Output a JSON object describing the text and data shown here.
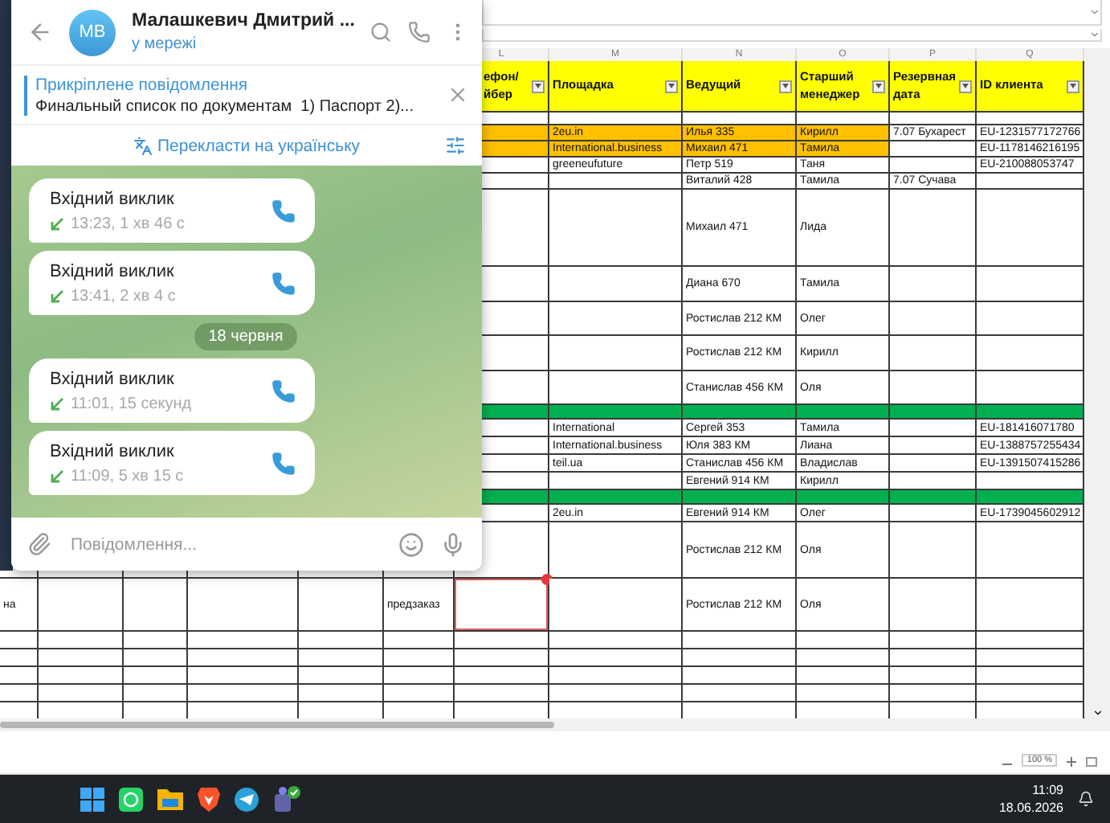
{
  "chat": {
    "contact": {
      "initials": "MB",
      "name": "Малашкевич Дмитрий ...",
      "status": "у мережі"
    },
    "pinned": {
      "label": "Прикріплене повідомлення",
      "text": "Финальный список по документам  1) Паспорт 2)..."
    },
    "translate": "Перекласти на українську",
    "messages": [
      {
        "kind": "call",
        "title": "Вхідний виклик",
        "detail": "13:23, 1 хв 46 с"
      },
      {
        "kind": "call",
        "title": "Вхідний виклик",
        "detail": "13:41, 2 хв 4 с"
      },
      {
        "kind": "date",
        "text": "18 червня"
      },
      {
        "kind": "call",
        "title": "Вхідний виклик",
        "detail": "11:01, 15 секунд"
      },
      {
        "kind": "call",
        "title": "Вхідний виклик",
        "detail": "11:09, 5 хв 15 с"
      }
    ],
    "composer": {
      "placeholder": "Повідомлення..."
    }
  },
  "sheet": {
    "columns": [
      {
        "letter": "L",
        "heading": "ефон/ йбер"
      },
      {
        "letter": "M",
        "heading": "Площадка"
      },
      {
        "letter": "N",
        "heading": "Ведущий"
      },
      {
        "letter": "O",
        "heading": "Старший менеджер"
      },
      {
        "letter": "P",
        "heading": "Резервная дата"
      },
      {
        "letter": "Q",
        "heading": "ID клиента"
      }
    ],
    "rows": [
      {
        "kind": "data",
        "highlight": true,
        "selected": false,
        "cells": [
          null,
          null,
          null,
          null,
          null,
          null,
          null,
          "2eu.in",
          "Илья 335",
          "Кирилл",
          "7.07 Бухарест",
          "EU-1231577172766"
        ]
      },
      {
        "kind": "data",
        "highlight": true,
        "selected": false,
        "cells": [
          null,
          null,
          null,
          null,
          null,
          null,
          null,
          "International.business",
          "Михаил 471",
          "Тамила",
          null,
          "EU-1178146216195"
        ]
      },
      {
        "kind": "data",
        "highlight": false,
        "selected": false,
        "cells": [
          null,
          null,
          null,
          null,
          null,
          null,
          null,
          "greeneufuture",
          "Петр 519",
          "Таня",
          null,
          "EU-210088053747"
        ]
      },
      {
        "kind": "data",
        "highlight": false,
        "selected": false,
        "cells": [
          null,
          null,
          null,
          null,
          null,
          null,
          null,
          null,
          "Виталий 428",
          "Тамила",
          "7.07 Сучава",
          null
        ]
      },
      {
        "kind": "data",
        "highlight": false,
        "selected": false,
        "cells": [
          null,
          null,
          null,
          null,
          null,
          null,
          null,
          null,
          "Михаил 471",
          "Лида",
          null,
          null
        ]
      },
      {
        "kind": "data",
        "highlight": false,
        "selected": false,
        "cells": [
          null,
          null,
          null,
          null,
          null,
          null,
          null,
          null,
          "Диана 670",
          "Тамила",
          null,
          null
        ]
      },
      {
        "kind": "data",
        "highlight": false,
        "selected": false,
        "cells": [
          null,
          null,
          null,
          null,
          null,
          null,
          null,
          null,
          "Ростислав 212 КМ",
          "Олег",
          null,
          null
        ]
      },
      {
        "kind": "data",
        "highlight": false,
        "selected": false,
        "cells": [
          null,
          null,
          null,
          null,
          null,
          null,
          null,
          null,
          "Ростислав 212 КМ",
          "Кирилл",
          null,
          null
        ]
      },
      {
        "kind": "data",
        "highlight": false,
        "selected": false,
        "cells": [
          null,
          null,
          null,
          null,
          null,
          null,
          null,
          null,
          "Станислав 456 КМ",
          "Оля",
          null,
          null
        ]
      },
      {
        "kind": "band"
      },
      {
        "kind": "data",
        "highlight": false,
        "selected": false,
        "cells": [
          null,
          null,
          null,
          null,
          null,
          null,
          null,
          "International",
          "Сергей 353",
          "Тамила",
          null,
          "EU-181416071780"
        ]
      },
      {
        "kind": "data",
        "highlight": false,
        "selected": false,
        "cells": [
          null,
          null,
          null,
          null,
          null,
          null,
          null,
          "International.business",
          "Юля 383 КМ",
          "Лиана",
          null,
          "EU-1388757255434"
        ]
      },
      {
        "kind": "data",
        "highlight": false,
        "selected": false,
        "cells": [
          null,
          null,
          null,
          null,
          null,
          null,
          null,
          "teil.ua",
          "Станислав 456 КМ",
          "Владислав",
          null,
          "EU-1391507415286"
        ]
      },
      {
        "kind": "data",
        "highlight": false,
        "selected": false,
        "cells": [
          null,
          null,
          null,
          null,
          null,
          null,
          null,
          null,
          "Евгений 914 КМ",
          "Кирилл",
          null,
          null
        ]
      },
      {
        "kind": "band"
      },
      {
        "kind": "data",
        "highlight": false,
        "selected": false,
        "cells": [
          null,
          null,
          null,
          null,
          null,
          null,
          null,
          "2eu.in",
          "Евгений 914 КМ",
          "Олег",
          null,
          "EU-1739045602912"
        ]
      },
      {
        "kind": "data",
        "highlight": false,
        "selected": false,
        "cells": [
          null,
          null,
          null,
          null,
          null,
          null,
          null,
          null,
          "Ростислав 212 КМ",
          "Оля",
          null,
          null
        ]
      },
      {
        "kind": "data",
        "highlight": false,
        "selected": true,
        "cells": [
          "на",
          null,
          null,
          null,
          null,
          "предзаказ",
          null,
          null,
          "Ростислав 212 КМ",
          "Оля",
          null,
          null
        ]
      }
    ],
    "zoom": "100 %"
  },
  "taskbar": {
    "time": "11:09",
    "date": "18.06.2026"
  }
}
